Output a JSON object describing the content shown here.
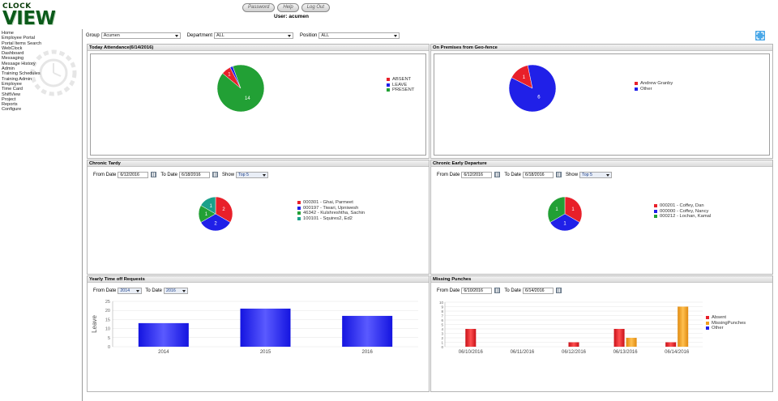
{
  "header": {
    "logo_top": "CLOCK",
    "logo_bottom": "VIEW",
    "buttons": [
      "Password",
      "Help",
      "Log Out"
    ],
    "user_label": "User: acumen"
  },
  "sidebar": {
    "items": [
      "Home",
      "Employee Portal",
      "Portal Items Search",
      "WebClock",
      "Dashboard",
      "Messaging",
      "Message History",
      "Admin",
      "Training Schedules",
      "Training Admin",
      "Employee",
      "Time Card",
      "ShiftView",
      "Project",
      "Reports",
      "Configure"
    ]
  },
  "filters": {
    "group_label": "Group",
    "group_value": "Acumen",
    "department_label": "Department",
    "department_value": "ALL",
    "position_label": "Position",
    "position_value": "ALL"
  },
  "panels": {
    "attendance": {
      "title": "Today Attendance(6/14/2016)",
      "legend": [
        "ABSENT",
        "LEAVE",
        "PRESENT"
      ],
      "slice_labels": [
        "1",
        "14"
      ]
    },
    "geofence": {
      "title": "On Premises from Geo-fence",
      "legend": [
        "Andrew Granby",
        "Other"
      ],
      "slice_labels": [
        "1",
        "6"
      ]
    },
    "tardy": {
      "title": "Chronic Tardy",
      "from_label": "From Date",
      "from_value": "6/12/2016",
      "to_label": "To Date",
      "to_value": "6/18/2016",
      "show_label": "Show",
      "show_value": "Top 5",
      "legend": [
        "000301 - Ghai, Parmeet",
        "000197 - Tiwari, Upniwesh",
        "46342 - Kulshreshtha, Sachin",
        "100101 - Squires2, Ed2"
      ],
      "slice_labels": [
        "2",
        "2",
        "1",
        "1"
      ]
    },
    "early": {
      "title": "Chronic Early Departure",
      "from_label": "From Date",
      "from_value": "6/12/2016",
      "to_label": "To Date",
      "to_value": "6/18/2016",
      "show_label": "Show",
      "show_value": "Top 5",
      "legend": [
        "000201 - Coffey, Dan",
        "000000 - Coffey, Nancy",
        "000212 - Lochan, Kamal"
      ],
      "slice_labels": [
        "1",
        "1",
        "1"
      ]
    },
    "timeoff": {
      "title": "Yearly Time off Requests",
      "from_label": "From Date",
      "from_value": "2014",
      "to_label": "To Date",
      "to_value": "2016"
    },
    "missing": {
      "title": "Missing Punches",
      "from_label": "From Date",
      "from_value": "6/10/2016",
      "to_label": "To Date",
      "to_value": "6/14/2016"
    }
  },
  "colors": {
    "red": "#e8202a",
    "blue": "#2020e8",
    "green": "#22a035",
    "teal": "#1aa08a",
    "orange": "#f0a020"
  },
  "chart_data": [
    {
      "type": "pie",
      "categories": [
        "ABSENT",
        "LEAVE",
        "PRESENT"
      ],
      "values": [
        1,
        0.3,
        14
      ]
    },
    {
      "type": "pie",
      "categories": [
        "Andrew Granby",
        "Other"
      ],
      "values": [
        1,
        6
      ]
    },
    {
      "type": "pie",
      "categories": [
        "000301 - Ghai, Parmeet",
        "000197 - Tiwari, Upniwesh",
        "46342 - Kulshreshtha, Sachin",
        "100101 - Squires2, Ed2"
      ],
      "values": [
        2,
        2,
        1,
        1
      ]
    },
    {
      "type": "pie",
      "categories": [
        "000201 - Coffey, Dan",
        "000000 - Coffey, Nancy",
        "000212 - Lochan, Kamal"
      ],
      "values": [
        1,
        1,
        1
      ]
    },
    {
      "type": "bar",
      "categories": [
        "2014",
        "2015",
        "2016"
      ],
      "values": [
        13,
        21,
        17
      ],
      "ylabel": "Leave",
      "ylim": [
        0,
        25
      ],
      "yticks": [
        0,
        5,
        10,
        15,
        20,
        25
      ]
    },
    {
      "type": "bar",
      "categories": [
        "06/10/2016",
        "06/11/2016",
        "06/12/2016",
        "06/13/2016",
        "06/14/2016"
      ],
      "series": [
        {
          "name": "Absent",
          "values": [
            4,
            0,
            1,
            4,
            1
          ]
        },
        {
          "name": "MissingPunches",
          "values": [
            0,
            0,
            0,
            2,
            9
          ]
        },
        {
          "name": "Other",
          "values": [
            0,
            0,
            0,
            0,
            0
          ]
        }
      ],
      "ylim": [
        0,
        10
      ],
      "yticks": [
        0,
        1,
        2,
        3,
        4,
        5,
        6,
        7,
        8,
        9,
        10
      ]
    }
  ]
}
